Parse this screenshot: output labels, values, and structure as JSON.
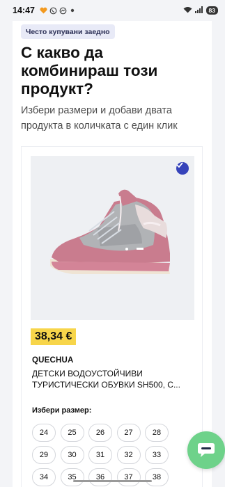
{
  "status_bar": {
    "time": "14:47",
    "battery": "83",
    "left_icons": [
      "heart-icon",
      "viber-icon",
      "messenger-icon",
      "notification-dot-icon"
    ],
    "right_icons": [
      "wifi-icon",
      "signal-icon",
      "battery-icon"
    ]
  },
  "section": {
    "chip": "Често купувани заедно",
    "headline": "С какво да комбинираш този продукт?",
    "subtitle": "Избери размери и добави двата продукта в количката с един клик"
  },
  "product": {
    "price": "38,34 €",
    "brand": "QUECHUA",
    "name": "Детски водоустойчиви туристически обувки SH500, с...",
    "image_icon": "hiking-shoe-image",
    "selected": true,
    "size_label": "Избери размер:",
    "sizes": [
      "24",
      "25",
      "26",
      "27",
      "28",
      "29",
      "30",
      "31",
      "32",
      "33",
      "34",
      "35",
      "36",
      "37",
      "38"
    ]
  },
  "colors": {
    "accent": "#3643ba",
    "price_tag": "#f7d54a",
    "chat_fab": "#6ed28a",
    "chip_bg": "#e8eaf7"
  }
}
